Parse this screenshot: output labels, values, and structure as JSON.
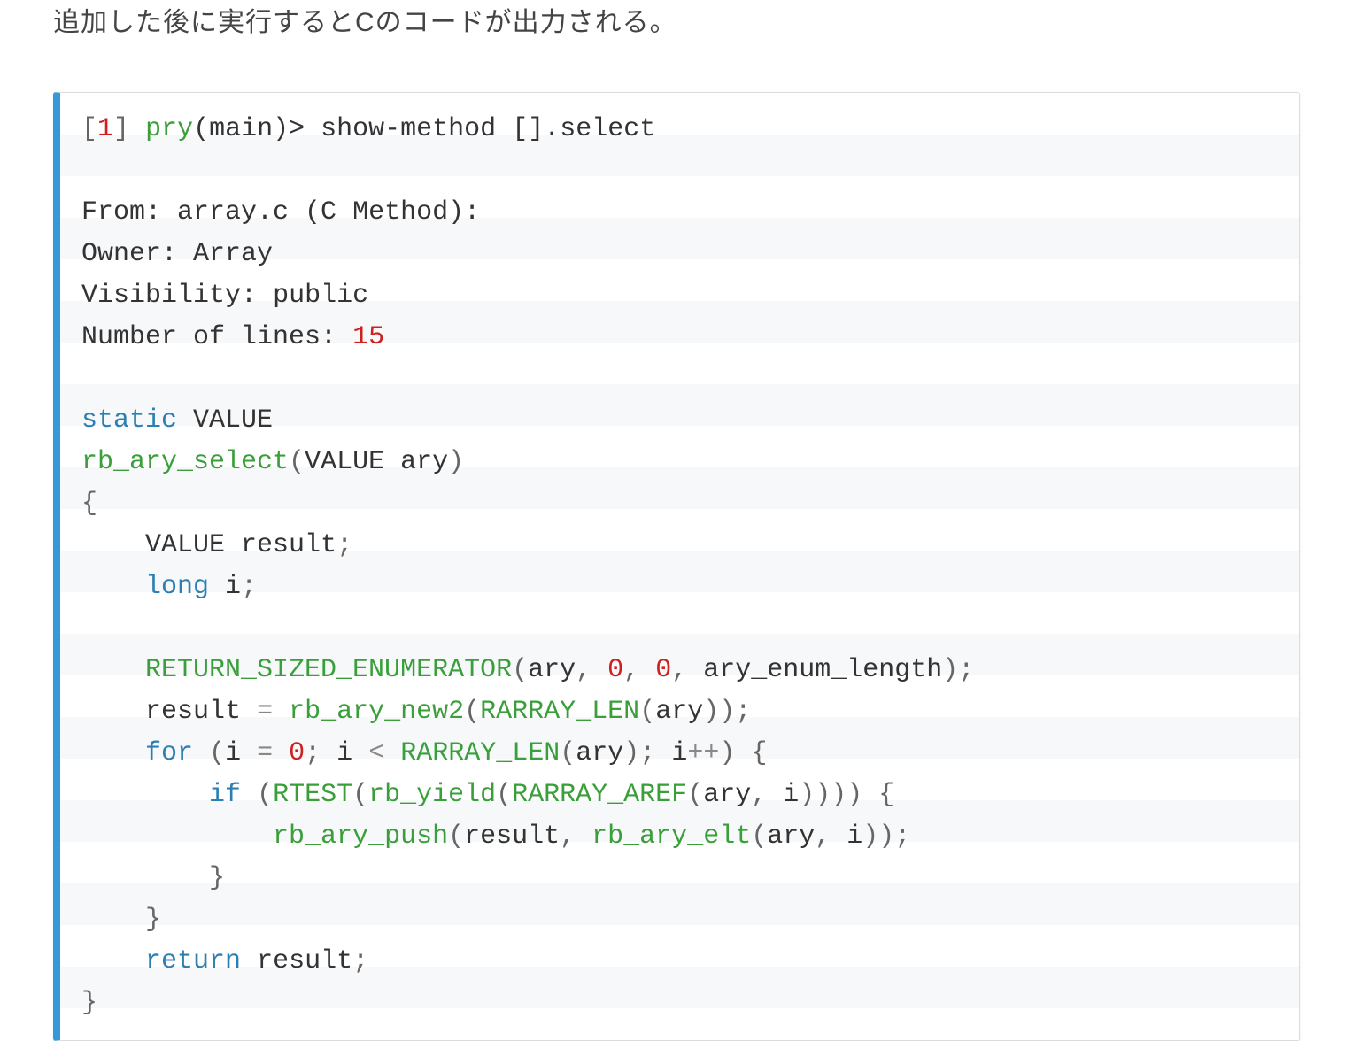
{
  "intro_text": "追加した後に実行するとCのコードが出力される。",
  "prompt": {
    "open": "[",
    "num": "1",
    "close": "]",
    "pry": "pry",
    "main": "(main)>",
    "cmd": "show-method",
    "arg": "[].select"
  },
  "meta": {
    "from_label": "From:",
    "from_value": "array.c (C Method):",
    "owner_label": "Owner:",
    "owner_value": "Array",
    "vis_label": "Visibility:",
    "vis_value": "public",
    "lines_label": "Number of lines:",
    "lines_value": "15"
  },
  "kw": {
    "static": "static",
    "long": "long",
    "for": "for",
    "if": "if",
    "return": "return"
  },
  "fn": {
    "rb_ary_select": "rb_ary_select",
    "RETURN_SIZED_ENUMERATOR": "RETURN_SIZED_ENUMERATOR",
    "rb_ary_new2": "rb_ary_new2",
    "RARRAY_LEN": "RARRAY_LEN",
    "RTEST": "RTEST",
    "rb_yield": "rb_yield",
    "RARRAY_AREF": "RARRAY_AREF",
    "rb_ary_push": "rb_ary_push",
    "rb_ary_elt": "rb_ary_elt"
  },
  "id": {
    "VALUE": "VALUE",
    "ary": "ary",
    "result": "result",
    "i": "i",
    "ary_enum_length": "ary_enum_length"
  },
  "num": {
    "zero": "0"
  }
}
